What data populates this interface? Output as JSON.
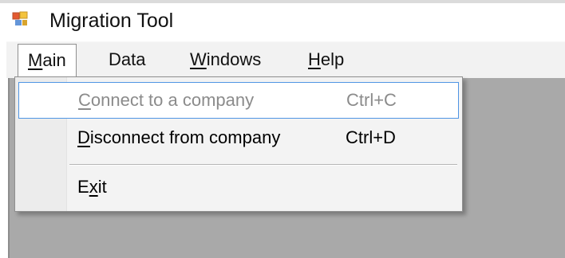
{
  "window": {
    "title": "Migration Tool",
    "icon": "application-window-icon"
  },
  "menubar": {
    "items": [
      {
        "prefix": "",
        "mnemonic": "M",
        "suffix": "ain",
        "active": true
      },
      {
        "prefix": "Data",
        "mnemonic": "",
        "suffix": "",
        "active": false
      },
      {
        "prefix": "",
        "mnemonic": "W",
        "suffix": "indows",
        "active": false
      },
      {
        "prefix": "",
        "mnemonic": "H",
        "suffix": "elp",
        "active": false
      }
    ]
  },
  "dropdown": {
    "items": [
      {
        "mnemonic": "C",
        "label_rest": "onnect to a company",
        "shortcut": "Ctrl+C",
        "enabled": false,
        "highlighted": true
      },
      {
        "mnemonic": "D",
        "label_rest": "isconnect from company",
        "shortcut": "Ctrl+D",
        "enabled": true,
        "highlighted": false
      },
      {
        "label_prefix": "E",
        "mnemonic": "x",
        "label_rest": "it",
        "shortcut": "",
        "enabled": true,
        "highlighted": false
      }
    ]
  },
  "colors": {
    "menu_background": "#f2f2f2",
    "client_background": "#a9a9a9",
    "highlight_border": "#4f95e4",
    "disabled_text": "#8b8b8b"
  }
}
